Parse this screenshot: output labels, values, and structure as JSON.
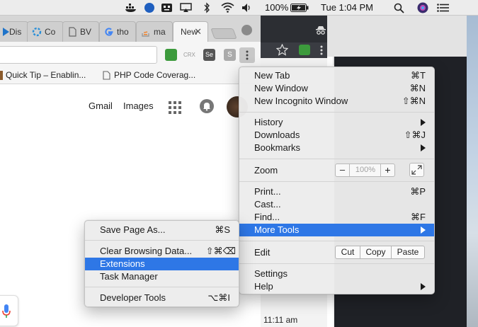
{
  "menubar": {
    "battery": "100%",
    "clock": "Tue 1:04 PM"
  },
  "tabs": [
    {
      "title": "Dis"
    },
    {
      "title": "Co"
    },
    {
      "title": "BV"
    },
    {
      "title": "tho"
    },
    {
      "title": "ma"
    },
    {
      "title": "New"
    }
  ],
  "toolbar": {
    "crx_label": "CRX",
    "se_label": "Se",
    "s_label": "S"
  },
  "bookmarks": [
    {
      "label": "Quick Tip – Enablin..."
    },
    {
      "label": "PHP Code Coverag..."
    }
  ],
  "page": {
    "links": [
      "Gmail",
      "Images"
    ]
  },
  "back_window": {
    "timestamp": "11:11 am"
  },
  "chrome_menu": {
    "items": {
      "new_tab": {
        "label": "New Tab",
        "shortcut": "⌘T"
      },
      "new_window": {
        "label": "New Window",
        "shortcut": "⌘N"
      },
      "new_incognito": {
        "label": "New Incognito Window",
        "shortcut": "⇧⌘N"
      },
      "history": {
        "label": "History"
      },
      "downloads": {
        "label": "Downloads",
        "shortcut": "⇧⌘J"
      },
      "bookmarks": {
        "label": "Bookmarks"
      },
      "zoom": {
        "label": "Zoom",
        "value": "100%",
        "minus": "–",
        "plus": "+"
      },
      "print": {
        "label": "Print...",
        "shortcut": "⌘P"
      },
      "cast": {
        "label": "Cast..."
      },
      "find": {
        "label": "Find...",
        "shortcut": "⌘F"
      },
      "more_tools": {
        "label": "More Tools"
      },
      "edit": {
        "label": "Edit",
        "cut": "Cut",
        "copy": "Copy",
        "paste": "Paste"
      },
      "settings": {
        "label": "Settings"
      },
      "help": {
        "label": "Help"
      }
    }
  },
  "more_tools_menu": {
    "items": {
      "save_page": {
        "label": "Save Page As...",
        "shortcut": "⌘S"
      },
      "clear_browsing": {
        "label": "Clear Browsing Data...",
        "shortcut": "⇧⌘⌫"
      },
      "extensions": {
        "label": "Extensions"
      },
      "task_manager": {
        "label": "Task Manager"
      },
      "developer_tools": {
        "label": "Developer Tools",
        "shortcut": "⌥⌘I"
      }
    }
  },
  "colors": {
    "highlight": "#2e77e6"
  }
}
